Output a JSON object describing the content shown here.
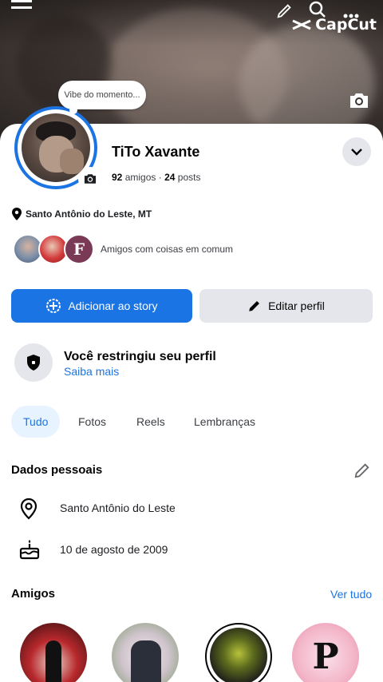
{
  "watermark": {
    "text": "CapCut"
  },
  "status_bubble": {
    "placeholder": "Vibe do momento..."
  },
  "profile": {
    "name": "TiTo Xavante",
    "friends_count": "92",
    "friends_label": "amigos",
    "separator": "·",
    "posts_count": "24",
    "posts_label": "posts",
    "location": "Santo Antônio do Leste, MT"
  },
  "mutual": {
    "text": "Amigos com coisas em comum",
    "third_initial": "F"
  },
  "buttons": {
    "add_story": "Adicionar ao story",
    "edit_profile": "Editar perfil"
  },
  "restriction": {
    "title": "Você restringiu seu perfil",
    "link": "Saiba mais"
  },
  "tabs": [
    "Tudo",
    "Fotos",
    "Reels",
    "Lembranças"
  ],
  "personal": {
    "title": "Dados pessoais",
    "hometown": "Santo Antônio do Leste",
    "birthday": "10 de agosto de 2009"
  },
  "friends": {
    "title": "Amigos",
    "see_all": "Ver tudo",
    "friend4_initial": "P"
  },
  "colors": {
    "accent": "#1b74e4",
    "secondary_button": "#e4e6eb",
    "active_tab_bg": "#e7f3ff"
  }
}
